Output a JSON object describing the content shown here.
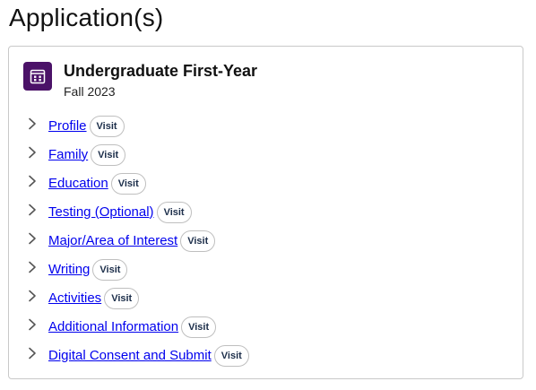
{
  "page": {
    "title": "Application(s)"
  },
  "application": {
    "title": "Undergraduate First-Year",
    "term": "Fall 2023",
    "icon": "calendar-icon",
    "icon_color": "#4b1268"
  },
  "colors": {
    "link": "#0b66b2",
    "visit_text": "#1c2e4a"
  },
  "sections": [
    {
      "label": "Profile",
      "visit_label": "Visit"
    },
    {
      "label": "Family",
      "visit_label": "Visit"
    },
    {
      "label": "Education",
      "visit_label": "Visit"
    },
    {
      "label": "Testing (Optional)",
      "visit_label": "Visit"
    },
    {
      "label": "Major/Area of Interest",
      "visit_label": "Visit"
    },
    {
      "label": "Writing",
      "visit_label": "Visit"
    },
    {
      "label": "Activities",
      "visit_label": "Visit"
    },
    {
      "label": "Additional Information",
      "visit_label": "Visit"
    },
    {
      "label": "Digital Consent and Submit",
      "visit_label": "Visit"
    }
  ]
}
